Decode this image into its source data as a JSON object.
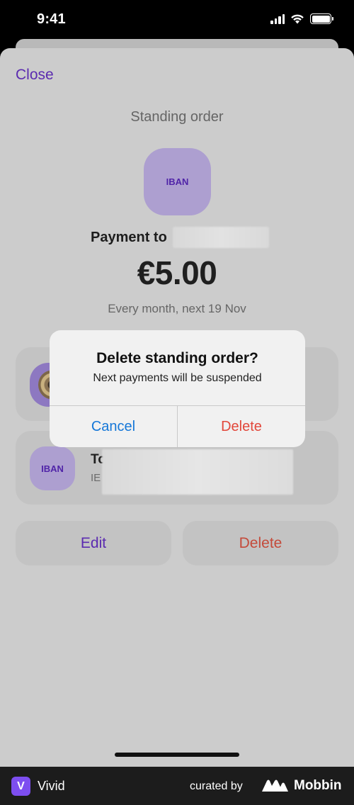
{
  "status_bar": {
    "time": "9:41",
    "icons": [
      "signal-icon",
      "wifi-icon",
      "battery-icon"
    ]
  },
  "sheet": {
    "close_label": "Close",
    "title": "Standing order",
    "iban_badge": "IBAN",
    "payment_to_label": "Payment to",
    "amount": "€5.00",
    "schedule": "Every month, next 19 Nov",
    "to_card": {
      "label": "To",
      "sub_prefix": "IE",
      "badge": "IBAN"
    },
    "edit_label": "Edit",
    "delete_label": "Delete"
  },
  "alert": {
    "title": "Delete standing order?",
    "message": "Next payments will be suspended",
    "cancel_label": "Cancel",
    "delete_label": "Delete"
  },
  "footer": {
    "app_letter": "V",
    "app_name": "Vivid",
    "curated_by": "curated by",
    "brand": "Mobbin"
  },
  "colors": {
    "accent_purple": "#5b2bb0",
    "destructive_red": "#e2473a",
    "ios_blue": "#1577d8",
    "iban_badge_bg": "#ad9fd0"
  }
}
